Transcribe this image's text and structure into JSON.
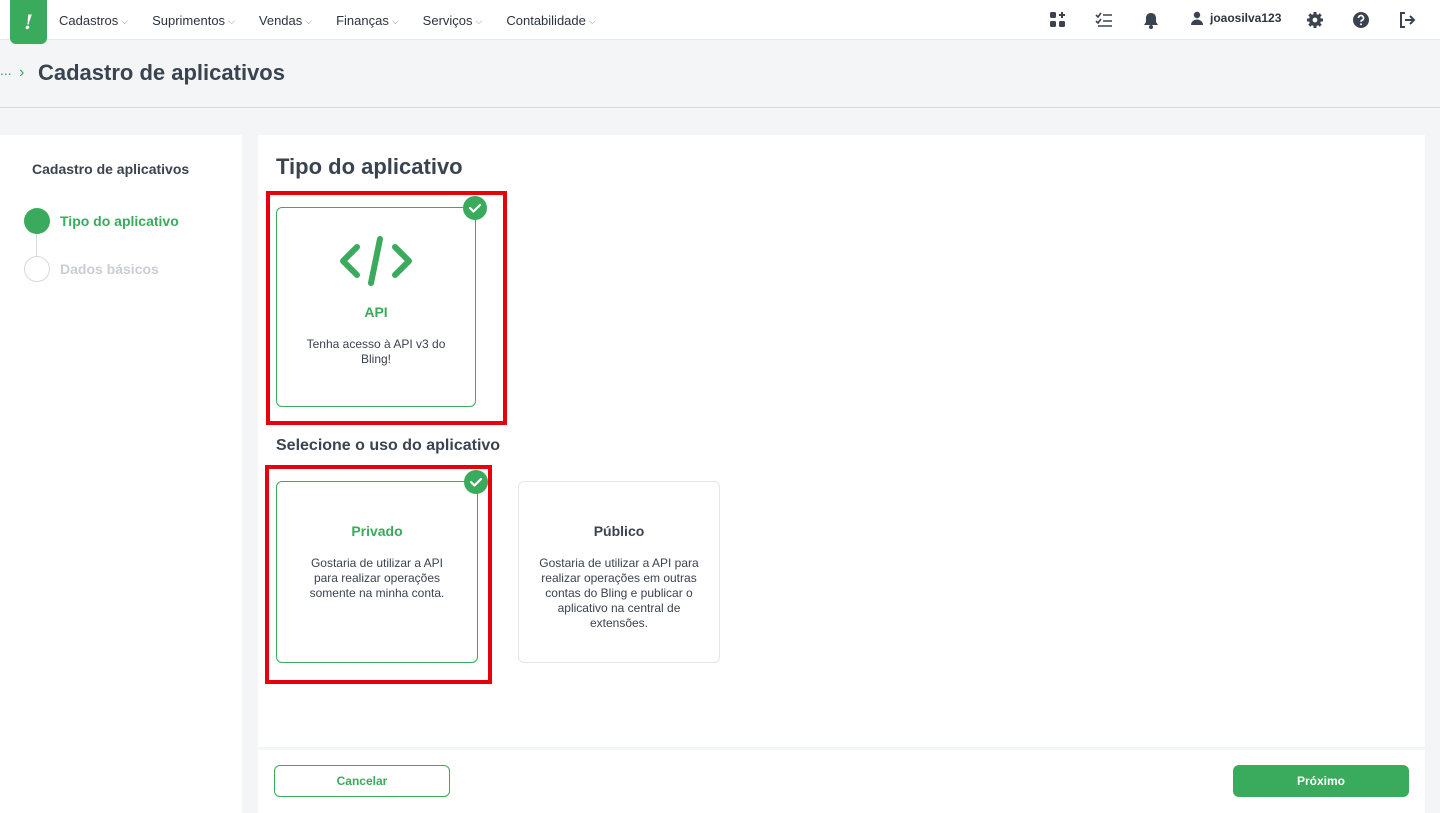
{
  "brand": {
    "logo_text": "!",
    "accent": "#3aaa5c"
  },
  "nav": {
    "items": [
      {
        "label": "Cadastros"
      },
      {
        "label": "Suprimentos"
      },
      {
        "label": "Vendas"
      },
      {
        "label": "Finanças"
      },
      {
        "label": "Serviços"
      },
      {
        "label": "Contabilidade"
      }
    ]
  },
  "topbar": {
    "username": "joaosilva123",
    "icons": [
      "apps-add-icon",
      "checklist-icon",
      "bell-icon",
      "user-icon",
      "gear-icon",
      "help-icon",
      "logout-icon"
    ]
  },
  "header": {
    "breadcrumb_ellipsis": "...",
    "breadcrumb_sep": "›",
    "title": "Cadastro de aplicativos"
  },
  "sidebar": {
    "title": "Cadastro de aplicativos",
    "steps": [
      {
        "label": "Tipo do aplicativo",
        "state": "active"
      },
      {
        "label": "Dados básicos",
        "state": "pending"
      }
    ]
  },
  "main": {
    "title": "Tipo do aplicativo",
    "type_card": {
      "icon": "code-icon",
      "title": "API",
      "description": "Tenha acesso à API v3 do Bling!",
      "selected": true
    },
    "usage_title": "Selecione o uso do aplicativo",
    "usage_cards": [
      {
        "title": "Privado",
        "description": "Gostaria de utilizar a API para realizar operações somente na minha conta.",
        "selected": true
      },
      {
        "title": "Público",
        "description": "Gostaria de utilizar a API para realizar operações em outras contas do Bling e publicar o aplicativo na central de extensões.",
        "selected": false
      }
    ]
  },
  "footer": {
    "cancel_label": "Cancelar",
    "next_label": "Próximo"
  }
}
